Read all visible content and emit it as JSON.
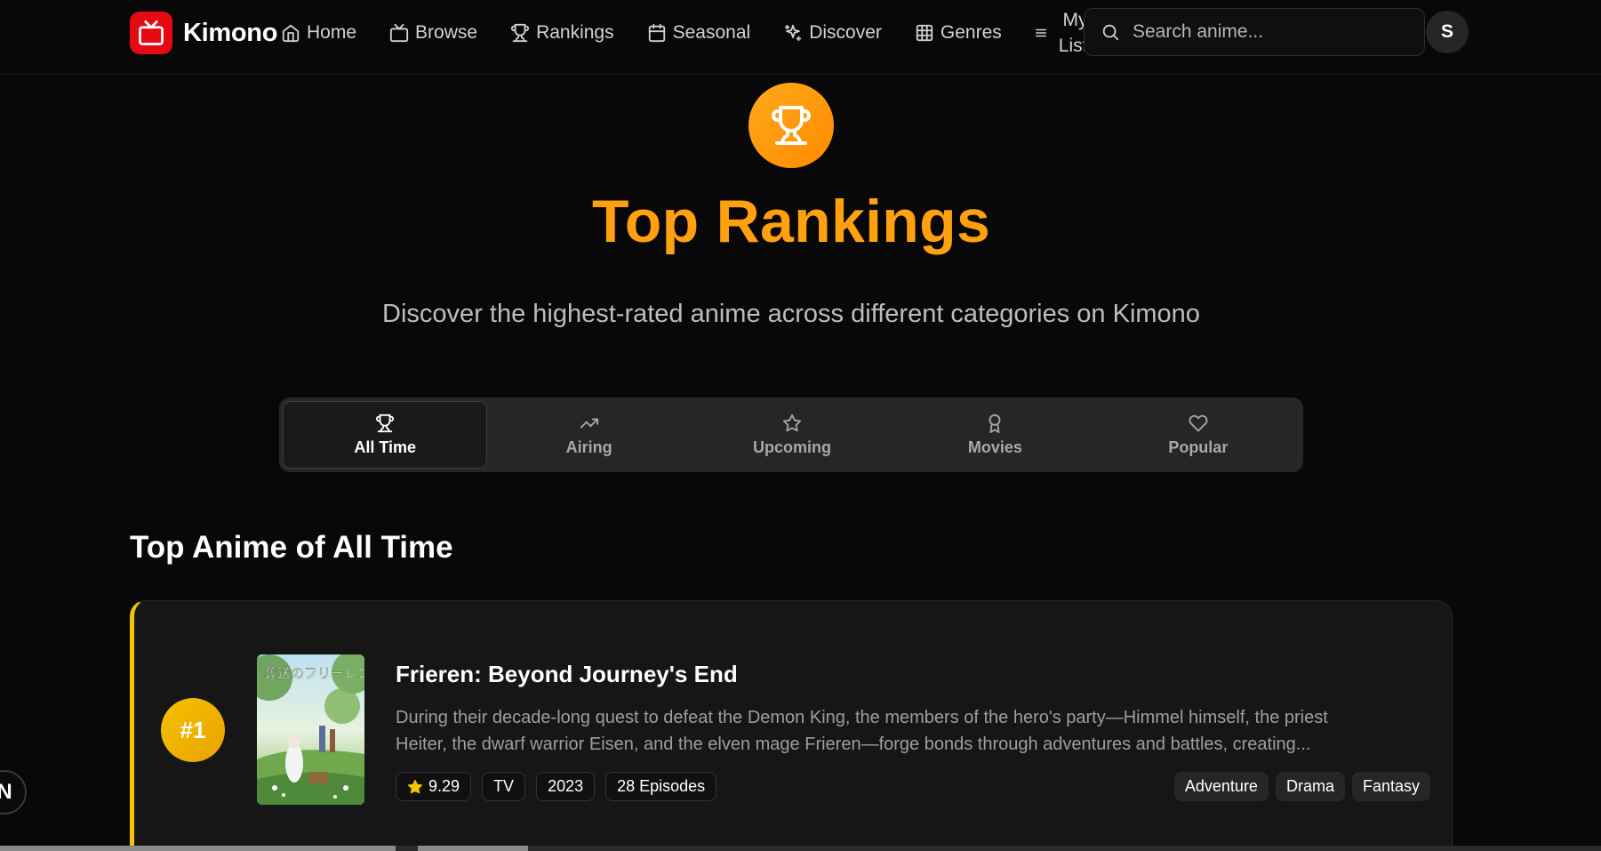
{
  "app": {
    "name": "Kimono",
    "brand_color": "#e50914",
    "accent_color": "#ffa00f"
  },
  "nav": {
    "items": [
      {
        "label": "Home",
        "icon": "home-icon"
      },
      {
        "label": "Browse",
        "icon": "tv-icon"
      },
      {
        "label": "Rankings",
        "icon": "trophy-icon"
      },
      {
        "label": "Seasonal",
        "icon": "calendar-icon"
      },
      {
        "label": "Discover",
        "icon": "sparkles-icon"
      },
      {
        "label": "Genres",
        "icon": "grid-icon"
      }
    ],
    "mylist": {
      "line1": "My",
      "line2": "List",
      "icon": "menu-icon"
    }
  },
  "search": {
    "placeholder": "Search anime..."
  },
  "user": {
    "initial": "S"
  },
  "hero": {
    "title": "Top Rankings",
    "subtitle": "Discover the highest-rated anime across different categories on Kimono",
    "icon": "trophy-icon"
  },
  "tabs": [
    {
      "label": "All Time",
      "icon": "trophy-icon",
      "active": true
    },
    {
      "label": "Airing",
      "icon": "trending-up-icon",
      "active": false
    },
    {
      "label": "Upcoming",
      "icon": "star-icon",
      "active": false
    },
    {
      "label": "Movies",
      "icon": "award-icon",
      "active": false
    },
    {
      "label": "Popular",
      "icon": "heart-icon",
      "active": false
    }
  ],
  "section": {
    "title": "Top Anime of All Time"
  },
  "rankings": [
    {
      "rank": "#1",
      "title": "Frieren: Beyond Journey's End",
      "synopsis_line1": "During their decade-long quest to defeat the Demon King, the members of the hero's party—Himmel himself, the priest",
      "synopsis_line2": "Heiter, the dwarf warrior Eisen, and the elven mage Frieren—forge bonds through adventures and battles, creating...",
      "score": "9.29",
      "type": "TV",
      "year": "2023",
      "episodes": "28 Episodes",
      "genres": [
        "Adventure",
        "Drama",
        "Fantasy"
      ],
      "poster_title": "葬送のフリーレン"
    }
  ],
  "floating": {
    "label": "N"
  }
}
